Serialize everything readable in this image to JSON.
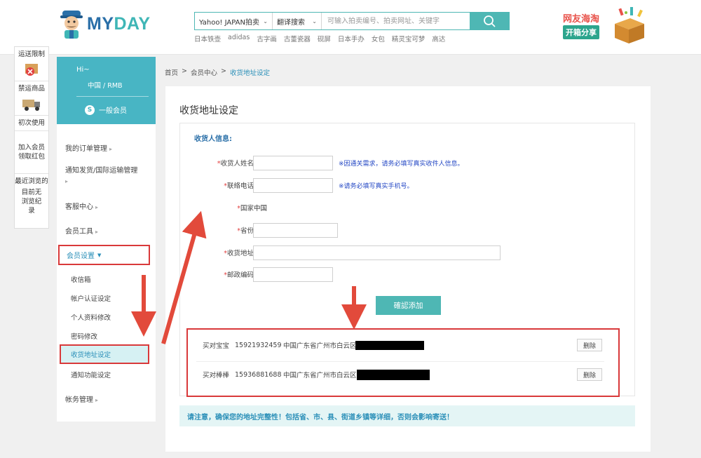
{
  "header": {
    "brand_left": "MY",
    "brand_right": "DAY",
    "search": {
      "site_select": "Yahoo! JAPAN拍卖",
      "translate_select": "翻译搜索",
      "placeholder": "可输入拍卖编号、拍卖网址、关键字"
    },
    "hot_words": [
      "日本铁壶",
      "adidas",
      "古字画",
      "古董瓷器",
      "砚屏",
      "日本手办",
      "女包",
      "精灵宝可梦",
      "高达"
    ],
    "banner": {
      "line1": "网友海淘",
      "line2": "开箱分享"
    }
  },
  "rail": {
    "items": [
      {
        "label": "运送限制"
      },
      {
        "label": "禁运商品"
      },
      {
        "label": "初次使用"
      },
      {
        "label": "加入会员\n领取红包"
      }
    ],
    "recent_title": "最近浏览的",
    "recent_empty": "目前无浏览纪录"
  },
  "sidebar": {
    "greeting": "Hi~",
    "region": "中国 / RMB",
    "member_badge": "S",
    "member_level": "一般会员",
    "nav": {
      "orders": "我的订单管理",
      "shipping": "通知发货/国际运输管理",
      "service": "客服中心",
      "tools": "会员工具",
      "settings": "会员设置",
      "account": "帐务管理"
    },
    "sub": {
      "inbox": "收信箱",
      "auth": "帐户认证设定",
      "profile": "个人资料修改",
      "password": "密码修改",
      "address": "收货地址设定",
      "notify": "通知功能设定"
    }
  },
  "breadcrumb": {
    "home": "首页",
    "sep": ">",
    "center": "会员中心",
    "current": "收货地址设定"
  },
  "main": {
    "title": "收货地址设定",
    "section": "收货人信息:",
    "form": {
      "name_label": "收货人姓名",
      "name_hint": "※因通关需求，请务必填写真实收件人信息。",
      "phone_label": "联络电话",
      "phone_hint": "※请务必填写真实手机号。",
      "country_label": "国家",
      "country_value": "中国",
      "province_label": "省份",
      "address_label": "收货地址",
      "zip_label": "邮政编码",
      "required_mark": "*"
    },
    "confirm_label": "確認添加",
    "addresses": [
      {
        "name": "买对宝宝",
        "phone": "15921932459",
        "address": "中国广东省广州市白云区",
        "delete_label": "删除"
      },
      {
        "name": "买对棒棒",
        "phone": "15936881688",
        "address": "中国广东省广州市白云区",
        "delete_label": "删除"
      }
    ],
    "notice": "请注意，确保您的地址完整性！包括省、市、县、街道乡镇等详细，否则会影响寄送！"
  },
  "colors": {
    "accent": "#4eb7b4",
    "sidebar_top": "#48b5c4",
    "highlight": "#d9393a",
    "link": "#2a8fb8"
  },
  "icons": [
    "search-icon",
    "mascot-logo",
    "gift-box-icon",
    "no-shipping-icon",
    "truck-icon",
    "caret-down-icon"
  ]
}
